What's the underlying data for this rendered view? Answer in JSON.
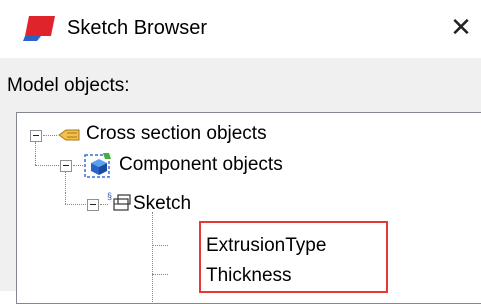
{
  "window": {
    "title": "Sketch Browser",
    "close_glyph": "✕",
    "icon": "sketch-app-icon"
  },
  "panel": {
    "label": "Model objects:"
  },
  "tree": {
    "nodes": [
      {
        "label": "Cross section objects",
        "icon": "cross-section-icon",
        "expanded": true
      },
      {
        "label": "Component objects",
        "icon": "component-icon",
        "expanded": true
      },
      {
        "label": "Sketch",
        "icon": "sketch-icon",
        "expanded": true
      },
      {
        "label": "ExtrusionType",
        "highlighted": true
      },
      {
        "label": "Thickness",
        "highlighted": true
      }
    ]
  },
  "colors": {
    "highlight_border": "#e53935",
    "app_icon_red": "#e0242b",
    "app_icon_blue": "#2a62c9"
  }
}
